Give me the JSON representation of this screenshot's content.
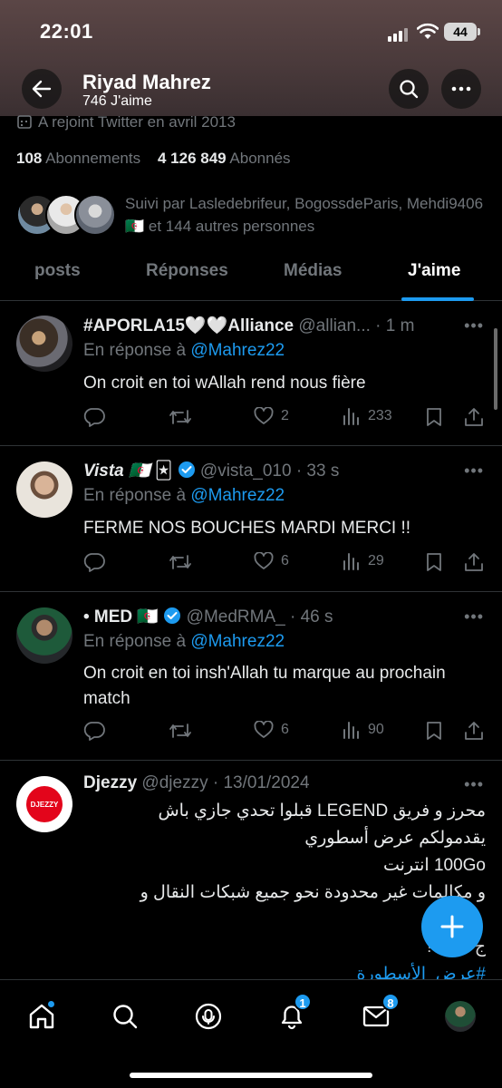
{
  "status": {
    "time": "22:01",
    "battery": "44"
  },
  "header": {
    "name": "Riyad Mahrez",
    "likes": "746 J'aime"
  },
  "profile": {
    "joined": "A rejoint Twitter en avril 2013",
    "following_count": "108",
    "following_label": "Abonnements",
    "followers_count": "4 126 849",
    "followers_label": "Abonnés",
    "followed_by": "Suivi par Lasledebrifeur, BogossdeParis, Mehdi9406 🇩🇿 et 144 autres personnes"
  },
  "tabs": [
    "posts",
    "Réponses",
    "Médias",
    "J'aime"
  ],
  "active_tab": "J'aime",
  "tweets": [
    {
      "name": "#APORLA15🤍🤍Alliance",
      "handle": "@allian...",
      "time": "· 1 m",
      "reply_prefix": "En réponse à",
      "reply_to": "@Mahrez22",
      "text": "On croit en toi wAllah rend nous fière",
      "likes": "2",
      "views": "233",
      "verified": false
    },
    {
      "name": "Vista 🇩🇿 🃏",
      "handle": "@vista_010",
      "time": "· 33 s",
      "reply_prefix": "En réponse à",
      "reply_to": "@Mahrez22",
      "text": "FERME NOS BOUCHES MARDI MERCI !!",
      "likes": "6",
      "views": "29",
      "verified": true
    },
    {
      "name": "• MED 🇩🇿",
      "handle": "@MedRMA_",
      "time": "· 46 s",
      "reply_prefix": "En réponse à",
      "reply_to": "@Mahrez22",
      "text": "On croit en toi insh'Allah tu marque au prochain match",
      "likes": "6",
      "views": "90",
      "verified": true
    },
    {
      "name": "Djezzy",
      "handle": "@djezzy",
      "time": "· 13/01/2024",
      "avatar_text": "DJEZZY",
      "lines": [
        "محرز و فريق LEGEND قبلوا تحدي جازي باش",
        "يقدمولكم عرض أسطوري",
        "100Go انترنت",
        "و مكالمات غير محدودة نحو جميع شبكات النقال و",
        "ج فقط !",
        "#عرض_الأسطورة"
      ]
    }
  ],
  "nav_badges": {
    "notifications": "1",
    "messages": "8"
  },
  "colors": {
    "accent": "#1d9bf0",
    "background": "#000000",
    "muted": "#71767b",
    "header": "#4a3a3b"
  }
}
